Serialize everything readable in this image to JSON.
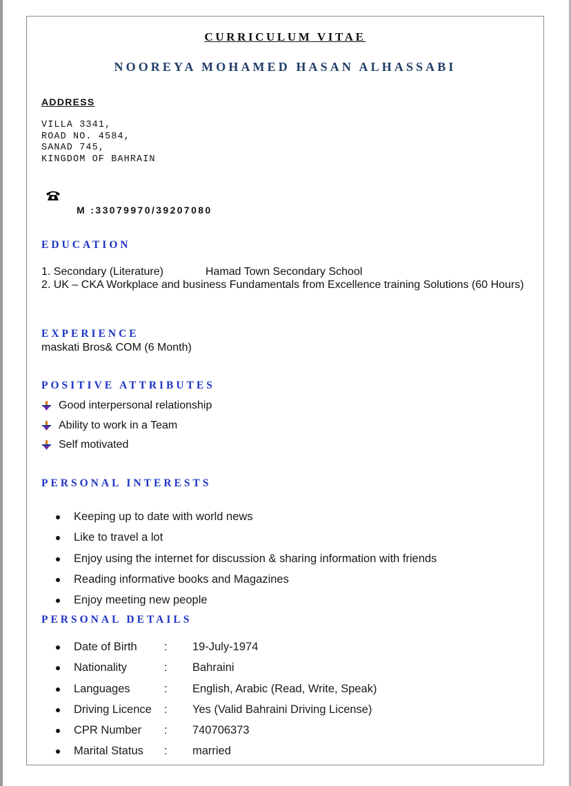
{
  "document": {
    "title": "CURRICULUM VITAE",
    "name": "NOOREYA MOHAMED HASAN ALHASSABI"
  },
  "address": {
    "heading": "ADDRESS",
    "lines": [
      "VILLA 3341,",
      "ROAD NO. 4584,",
      "SANAD 745,",
      "KINGDOM OF BAHRAIN"
    ]
  },
  "contact": {
    "icon": "telephone-icon",
    "mobile": "M  :33079970/39207080"
  },
  "education": {
    "heading": "EDUCATION",
    "items": [
      {
        "text": "1. Secondary (Literature)",
        "school": "Hamad Town Secondary School"
      },
      {
        "text": "2. UK – CKA Workplace and business Fundamentals from Excellence training Solutions (60 Hours)",
        "school": ""
      }
    ]
  },
  "experience": {
    "heading": "EXPERIENCE",
    "text": "maskati Bros& COM (6 Month)"
  },
  "attributes": {
    "heading": "POSITIVE ATTRIBUTES",
    "icon": "arrow-bullet-icon",
    "items": [
      "Good interpersonal relationship",
      "Ability to work in a Team",
      "Self motivated"
    ]
  },
  "interests": {
    "heading": "PERSONAL INTERESTS",
    "items": [
      "Keeping up to date with world news",
      "Like to travel a lot",
      "Enjoy using the internet for discussion & sharing information with friends",
      "Reading informative books and Magazines",
      "Enjoy meeting new people"
    ]
  },
  "details": {
    "heading": "PERSONAL DETAILS",
    "items": [
      {
        "label": "Date of Birth",
        "sep": ":",
        "value": "19-July-1974"
      },
      {
        "label": "Nationality",
        "sep": ":",
        "value": "Bahraini"
      },
      {
        "label": "Languages",
        "sep": ":",
        "value": "English, Arabic (Read, Write, Speak)"
      },
      {
        "label": "Driving Licence",
        "sep": ":",
        "value": "Yes (Valid Bahraini Driving License)"
      },
      {
        "label": "CPR Number",
        "sep": ":",
        "value": "740706373"
      },
      {
        "label": "Marital Status",
        "sep": ":",
        "value": "married"
      }
    ]
  },
  "colors": {
    "heading_blue": "#1c34c4",
    "name_navy": "#1f3d66"
  }
}
